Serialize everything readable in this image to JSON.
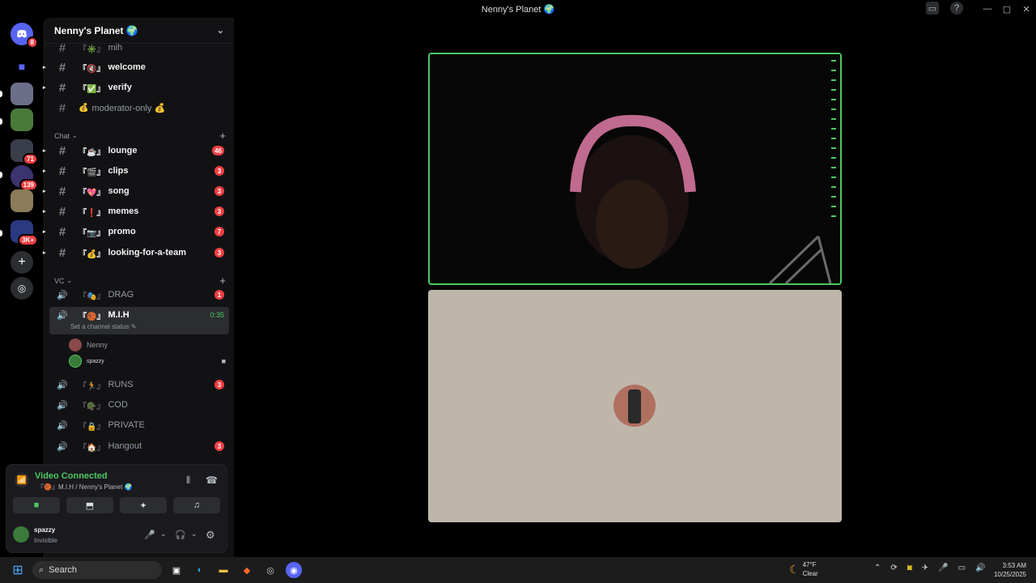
{
  "titlebar": {
    "title": "Nenny's Planet 🌍"
  },
  "server_list": [
    {
      "name": "discord-home-icon",
      "badge": "8"
    },
    {
      "name": "server-1",
      "badge": ""
    },
    {
      "name": "server-2",
      "badge": ""
    },
    {
      "name": "server-3",
      "badge": ""
    },
    {
      "name": "server-4",
      "badge": "71"
    },
    {
      "name": "server-5",
      "badge": "139"
    },
    {
      "name": "server-6",
      "badge": ""
    },
    {
      "name": "server-7",
      "badge": "3K+"
    }
  ],
  "sidebar": {
    "server_name": "Nenny's Planet 🌍",
    "top_channels": [
      {
        "emoji": "『✳️』",
        "name": "mih",
        "unread": false,
        "badge": ""
      },
      {
        "emoji": "『🔇』",
        "name": "welcome",
        "unread": true,
        "badge": ""
      },
      {
        "emoji": "『✅』",
        "name": "verify",
        "unread": true,
        "badge": ""
      },
      {
        "emoji": "💰",
        "name": "moderator-only 💰",
        "unread": false,
        "badge": ""
      }
    ],
    "chat_category": "Chat",
    "chat_channels": [
      {
        "emoji": "『☕』",
        "name": "lounge",
        "badge": "46"
      },
      {
        "emoji": "『🎬』",
        "name": "clips",
        "badge": "3"
      },
      {
        "emoji": "『💖』",
        "name": "song",
        "badge": "3"
      },
      {
        "emoji": "『❗』",
        "name": "memes",
        "badge": "3"
      },
      {
        "emoji": "『📷』",
        "name": "promo",
        "badge": "7"
      },
      {
        "emoji": "『💰』",
        "name": "looking-for-a-team",
        "badge": "3"
      }
    ],
    "vc_category": "VC",
    "voice_channels": [
      {
        "emoji": "『🎭』",
        "name": "DRAG",
        "badge": "1"
      },
      {
        "emoji": "『🏀』",
        "name": "M.I.H",
        "badge": ""
      },
      {
        "emoji": "『🏃』",
        "name": "RUNS",
        "badge": "3"
      },
      {
        "emoji": "『🪖』",
        "name": "COD",
        "badge": ""
      },
      {
        "emoji": "『🔒』",
        "name": "PRIVATE",
        "badge": ""
      },
      {
        "emoji": "『🏠』",
        "name": "Hangout",
        "badge": "3"
      }
    ],
    "active_vc": {
      "timer": "0:35",
      "status_placeholder": "Set a channel status",
      "members": [
        "Nenny",
        "spazzy"
      ]
    }
  },
  "voice_panel": {
    "status": "Video Connected",
    "channel": "『🏀』M.I.H / Nenny's Planet 🌍"
  },
  "user": {
    "name": "spazzy",
    "status": "Invisible"
  },
  "taskbar": {
    "search": "Search",
    "weather_temp": "47°F",
    "weather_desc": "Clear",
    "time": "3:53 AM",
    "date": "10/25/2025"
  },
  "colors": {
    "accent_green": "#4ec862",
    "badge_red": "#f23f43",
    "tile_bg": "#bfb6aa"
  }
}
